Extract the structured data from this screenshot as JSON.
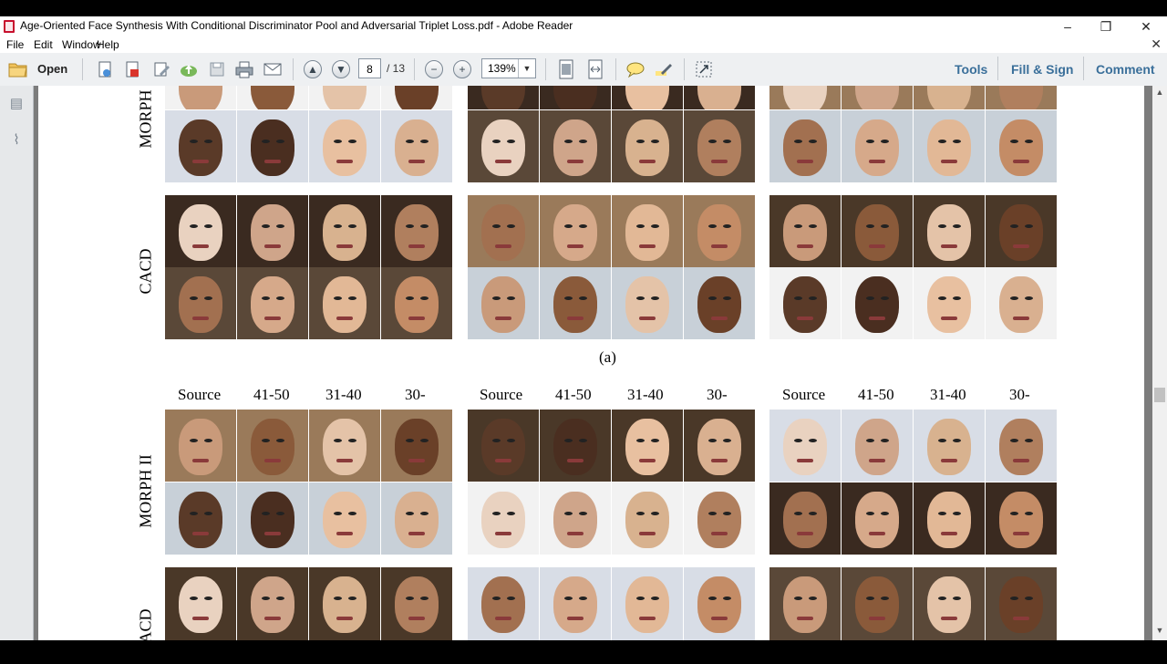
{
  "window": {
    "title": "Age-Oriented Face Synthesis With Conditional Discriminator Pool and Adversarial Triplet Loss.pdf - Adobe Reader",
    "controls": [
      "minimize",
      "restore",
      "close"
    ]
  },
  "menu": [
    "File",
    "Edit",
    "Window",
    "Help"
  ],
  "toolbar": {
    "open_label": "Open",
    "page_current": "8",
    "page_total": "/ 13",
    "zoom": "139%",
    "right_links": [
      "Tools",
      "Fill & Sign",
      "Comment"
    ],
    "icons": [
      "open-folder-icon",
      "create-pdf-icon",
      "export-pdf-icon",
      "edit-icon",
      "upload-cloud-icon",
      "save-icon",
      "print-icon",
      "email-icon",
      "prev-page-icon",
      "next-page-icon",
      "zoom-out-icon",
      "zoom-in-icon",
      "fit-page-icon",
      "fit-width-icon",
      "comment-bubble-icon",
      "highlight-icon",
      "fullscreen-icon"
    ]
  },
  "left_panel": {
    "icons": [
      "pages-icon",
      "attachments-icon"
    ]
  },
  "document": {
    "row_labels": [
      "MORPH",
      "CACD",
      "MORPH II",
      "CACD"
    ],
    "caption": "(a)",
    "column_headers": [
      "Source",
      "41-50",
      "31-40",
      "30-",
      "Source",
      "41-50",
      "31-40",
      "30-",
      "Source",
      "41-50",
      "31-40",
      "30-"
    ]
  },
  "colors": {
    "accent_link": "#3a6f9a",
    "toolbar_bg": "#eef0f2",
    "doc_bg": "#7c7c7c"
  }
}
